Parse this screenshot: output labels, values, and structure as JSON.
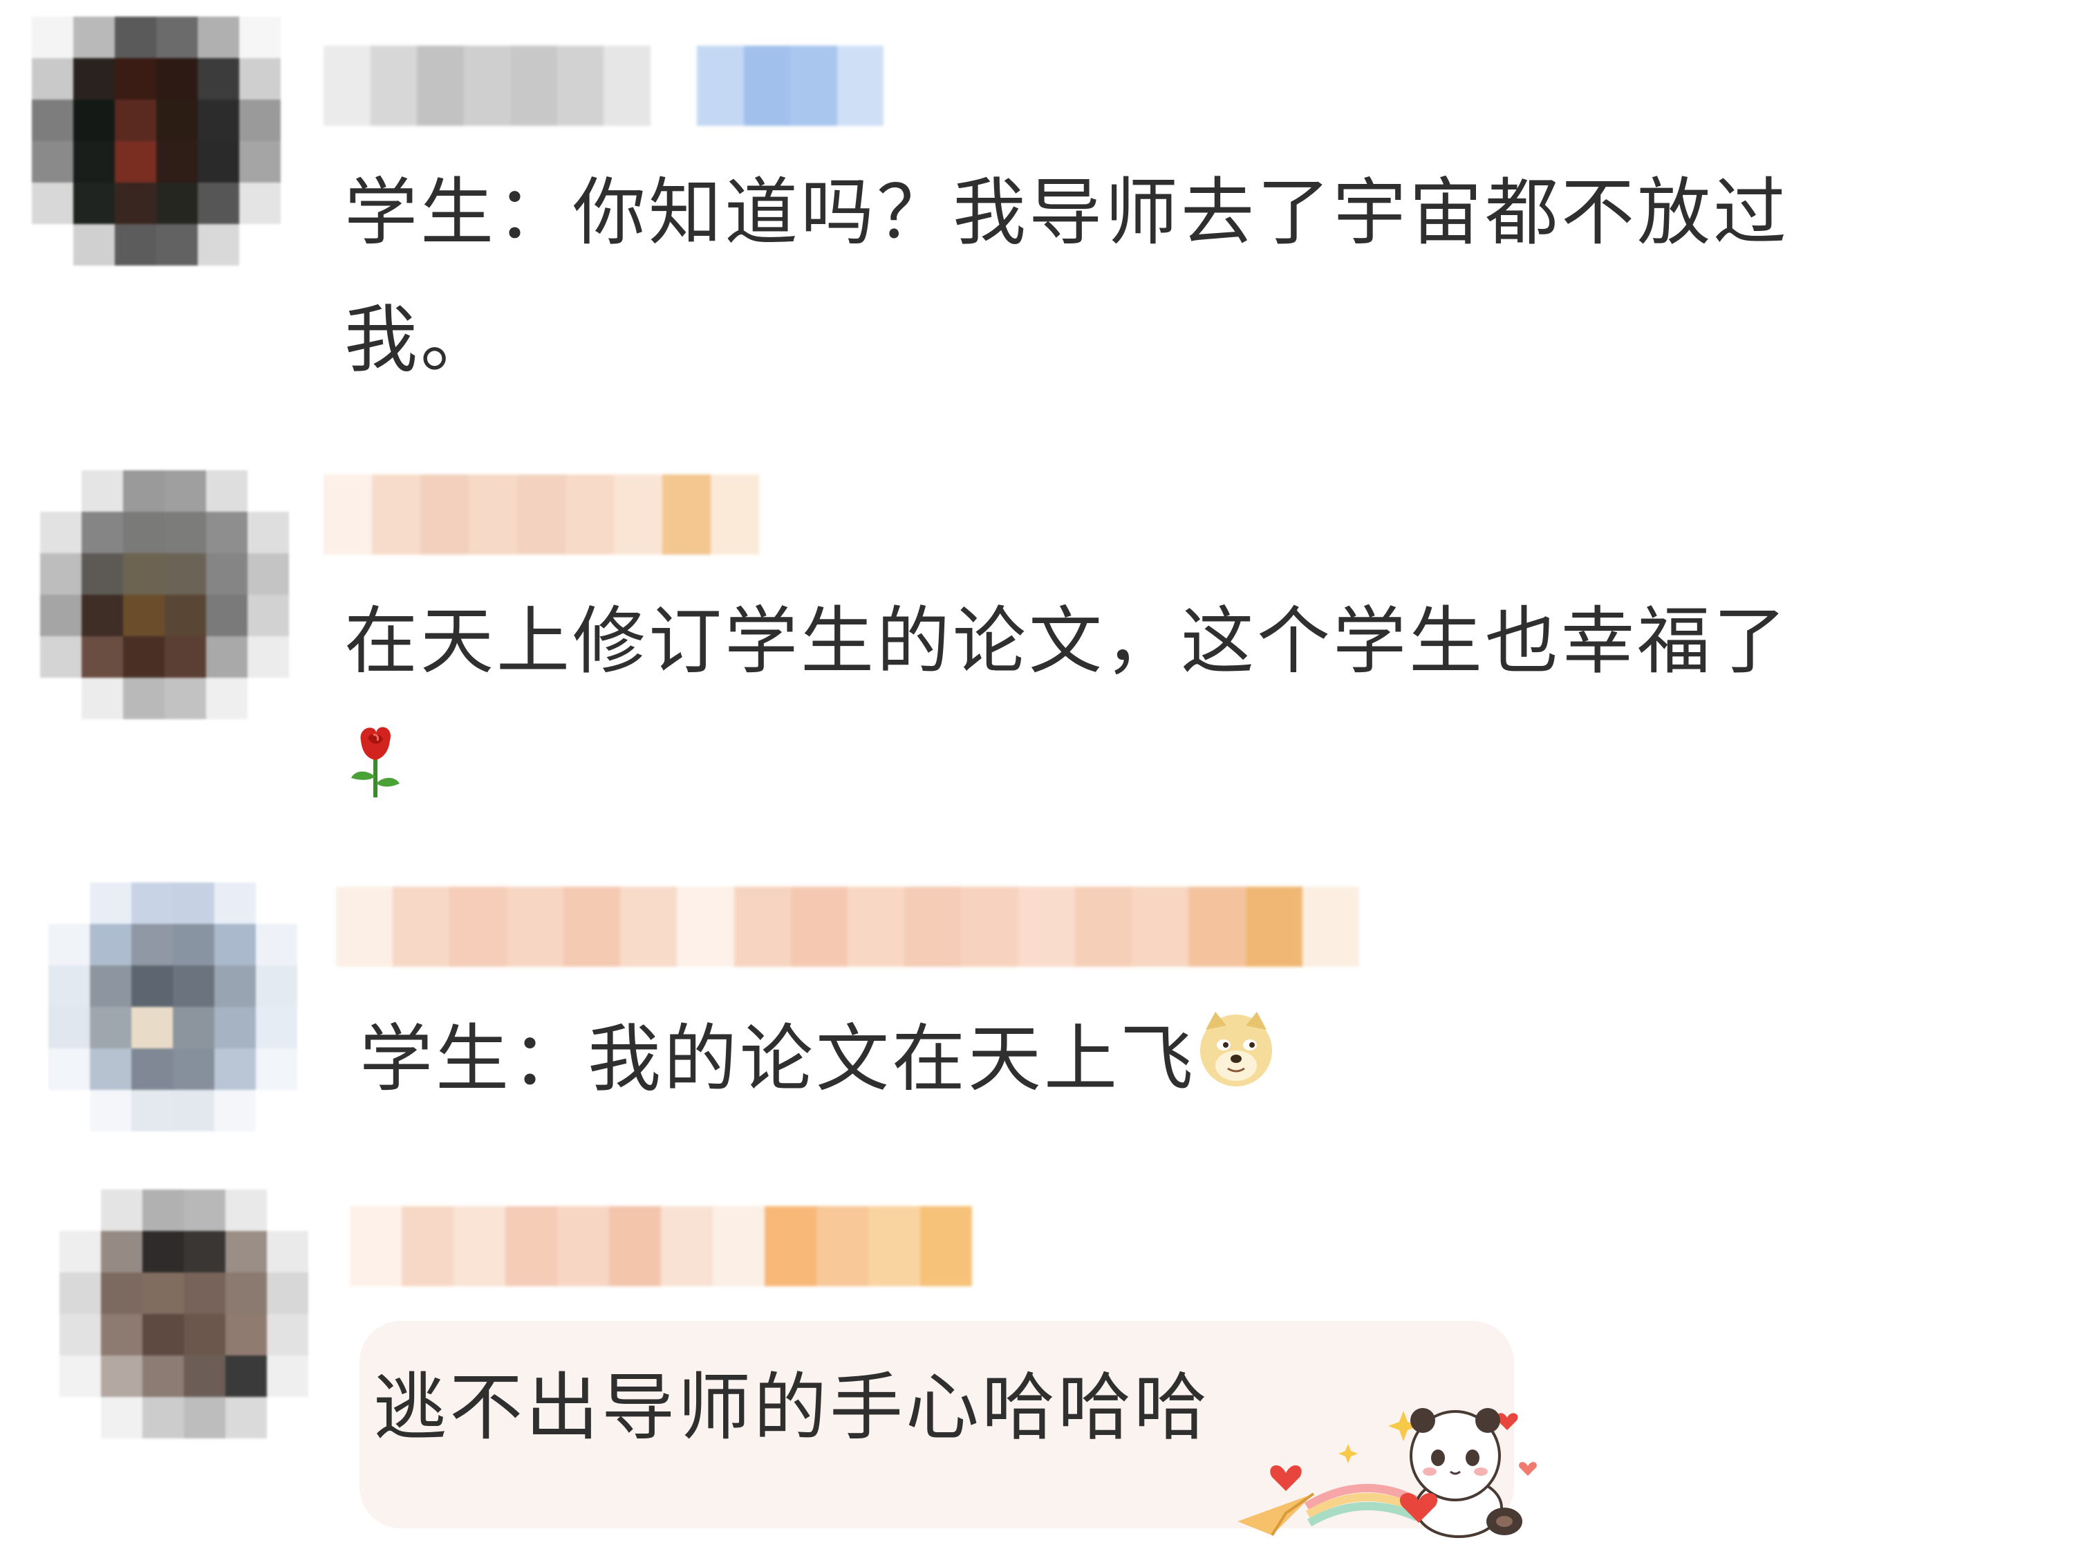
{
  "comments": [
    {
      "text_lines": [
        "学生：你知道吗？我导师去了宇宙都不放过",
        "我。"
      ],
      "avatar": {
        "colors": [
          "#f4f4f4",
          "#b9b9b9",
          "#5a5a5a",
          "#6b6b6b",
          "#b0b0b0",
          "#f6f6f6",
          "#c9c9c9",
          "#2a221e",
          "#3a1c14",
          "#2e1a14",
          "#3c3c3c",
          "#cfcfcf",
          "#7d7d7d",
          "#151915",
          "#5a2a20",
          "#2b1c14",
          "#2c2c2c",
          "#9a9a9a",
          "#8a8a8a",
          "#1a1e1a",
          "#7a2e22",
          "#2f1d17",
          "#2a2a2a",
          "#a5a5a5",
          "#d8d8d8",
          "#1f2420",
          "#3a2620",
          "#262620",
          "#565656",
          "#e4e4e4",
          "#ffffff",
          "#d0d0d0",
          "#5c5c5c",
          "#626262",
          "#d9d9d9",
          "#ffffff"
        ]
      },
      "username": {
        "colors": [
          "#ebebeb",
          "#d7d7d7",
          "#c2c2c2",
          "#cfcfcf",
          "#c8c8c8",
          "#d2d2d2",
          "#e6e6e6",
          "#ffffff",
          "#c4d8f4",
          "#a2c0ec",
          "#a8c6ee",
          "#cfe0f6"
        ]
      }
    },
    {
      "text_lines": [
        "在天上修订学生的论文，这个学生也幸福了",
        "🌹"
      ],
      "avatar": {
        "colors": [
          "#ffffff",
          "#e5e5e5",
          "#9a9a9a",
          "#9f9f9f",
          "#dedede",
          "#ffffff",
          "#e2e2e2",
          "#858585",
          "#7a7a78",
          "#7c7c7a",
          "#8e8e8e",
          "#dedede",
          "#bdbdbd",
          "#5d5a55",
          "#6c6350",
          "#6b6456",
          "#858585",
          "#c4c4c4",
          "#a5a5a5",
          "#3e2e26",
          "#6a4e2c",
          "#5a4634",
          "#7a7a7a",
          "#d2d2d2",
          "#d4d4d4",
          "#6a4e42",
          "#4a3024",
          "#5b3e34",
          "#a9a9a9",
          "#ececec",
          "#ffffff",
          "#ececec",
          "#b9b9b9",
          "#c2c2c2",
          "#efefef",
          "#ffffff"
        ]
      },
      "username": {
        "colors": [
          "#fdf0e8",
          "#f7dccb",
          "#f2d0bd",
          "#f6d9c6",
          "#f3d3bf",
          "#f7dac7",
          "#fae5d5",
          "#f4c690",
          "#fbead8"
        ]
      }
    },
    {
      "text_lines": [
        "学生：我的论文在天上飞"
      ],
      "avatar": {
        "colors": [
          "#ffffff",
          "#e9eef6",
          "#c8d4e6",
          "#c6d2e4",
          "#e9eef6",
          "#ffffff",
          "#f0f3f8",
          "#aebccf",
          "#8f98a4",
          "#8994a2",
          "#aab9cc",
          "#eef2f8",
          "#e3e9f1",
          "#8d96a0",
          "#5d6670",
          "#6a737e",
          "#98a4b2",
          "#e4eaf2",
          "#e1e7ef",
          "#9ea6ae",
          "#e8dcc8",
          "#8c949e",
          "#a6b3c3",
          "#e6ecf4",
          "#f2f5f9",
          "#b7c2d1",
          "#7f8894",
          "#86909c",
          "#bac6d6",
          "#f2f5f9",
          "#ffffff",
          "#f4f6fa",
          "#e4e9f0",
          "#e3e8ef",
          "#f4f6fa",
          "#ffffff"
        ]
      },
      "username": {
        "colors": [
          "#fcefe6",
          "#f7d8c6",
          "#f5cdb8",
          "#f7d6c3",
          "#f4cab3",
          "#f8dbc9",
          "#fdf1e9",
          "#f7d4c1",
          "#f5c9b1",
          "#f8d8c4",
          "#f5ccb6",
          "#f7d3bf",
          "#f9dccb",
          "#f6cfb9",
          "#f8d6c2",
          "#f4c39e",
          "#f0b774",
          "#fcefe2"
        ]
      }
    },
    {
      "text_lines": [
        "逃不出导师的手心哈哈哈"
      ],
      "avatar": {
        "colors": [
          "#ffffff",
          "#e4e4e4",
          "#b1b1b1",
          "#b8b8b8",
          "#e9e9e9",
          "#ffffff",
          "#eeeeee",
          "#958a84",
          "#2e2b2a",
          "#3a3634",
          "#9a8e86",
          "#eaeaea",
          "#d9d9d9",
          "#7c6a60",
          "#816c60",
          "#776359",
          "#8b7a70",
          "#d7d7d7",
          "#e2e2e2",
          "#8d7a70",
          "#5e4a40",
          "#6b574c",
          "#8f7b70",
          "#e2e2e2",
          "#f2f2f2",
          "#b3a8a2",
          "#8c7c73",
          "#6c5e56",
          "#3a3a3a",
          "#efefef",
          "#ffffff",
          "#f1f1f1",
          "#cccccc",
          "#bdbdbd",
          "#dadada",
          "#ffffff"
        ]
      },
      "username": {
        "colors": [
          "#fdf1e9",
          "#f7d8c6",
          "#f9e4d6",
          "#f5ccb6",
          "#f7d6c3",
          "#f3c6ac",
          "#f9e2d4",
          "#fcefe6",
          "#f7b878",
          "#f8c898",
          "#f9d4a0",
          "#f6c27a"
        ]
      }
    }
  ]
}
